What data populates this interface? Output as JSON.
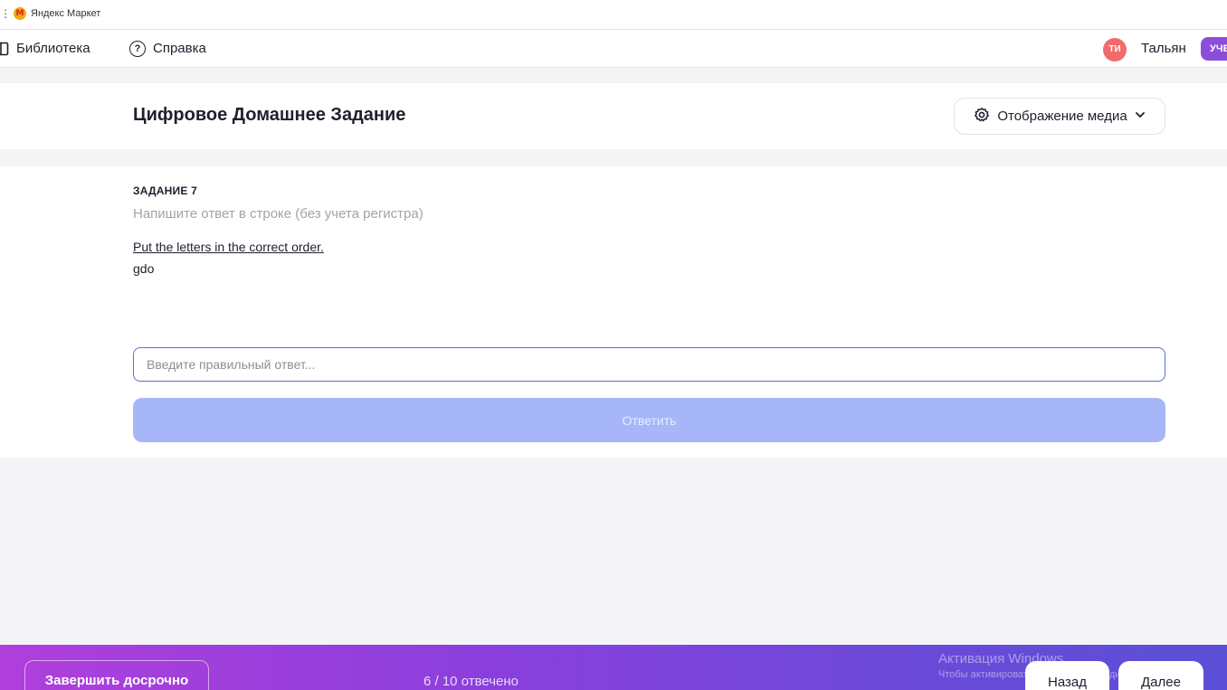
{
  "bookmarks": {
    "edge_glyph": "⋮",
    "items": [
      {
        "label": "Яндекс Маркет",
        "logo": "М"
      }
    ]
  },
  "nav": {
    "library": "Библиотека",
    "help": "Справка",
    "user_initials": "ТИ",
    "user_name": "Тальян",
    "role": "УЧЕ"
  },
  "header": {
    "title": "Цифровое Домашнее Задание",
    "media_button": "Отображение медиа"
  },
  "task": {
    "label": "ЗАДАНИЕ 7",
    "hint": "Напишите ответ в строке (без учета регистра)",
    "instruction": "Put the letters in the correct order.",
    "word": "gdo",
    "input_placeholder": "Введите правильный ответ...",
    "submit": "Ответить"
  },
  "footer": {
    "finish": "Завершить досрочно",
    "progress": "6 / 10 отвечено",
    "back": "Назад",
    "next": "Далее"
  },
  "watermark": {
    "title": "Активация Windows",
    "subtitle": "Чтобы активировать Windows, перейдите в раздел \"Па"
  },
  "colors": {
    "accent": "#5a6ed6",
    "submit_disabled": "#a6b6f8",
    "footer_gradient_start": "#b03fdc",
    "footer_gradient_end": "#5b4fd6",
    "avatar": "#f26b6b",
    "role_badge": "#8c4ddb"
  }
}
